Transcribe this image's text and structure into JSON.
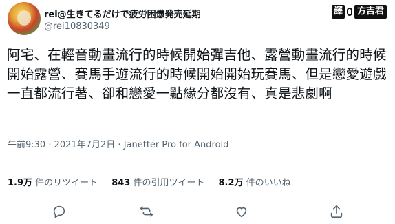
{
  "user": {
    "display_name": "rei@生きてるだけで疲労困憊発売延期",
    "handle": "@rei10830349"
  },
  "badge": {
    "seal": "譯",
    "name": "方吉君"
  },
  "tweet": {
    "text": "阿宅、在輕音動畫流行的時候開始彈吉他、露營動畫流行的時候開始露營、賽馬手遊流行的時候開始開始玩賽馬、但是戀愛遊戲一直都流行著、卻和戀愛一點緣分都沒有、真是悲劇啊",
    "time": "午前9:30",
    "date": "2021年7月2日",
    "source": "Janetter Pro for Android",
    "separator": "·"
  },
  "stats": {
    "retweets_count": "1.9万",
    "retweets_label": "件のリツイート",
    "quotes_count": "843",
    "quotes_label": "件の引用ツイート",
    "likes_count": "8.2万",
    "likes_label": "件のいいね"
  },
  "actions": [
    "reply-icon",
    "retweet-icon",
    "like-icon",
    "share-icon"
  ]
}
